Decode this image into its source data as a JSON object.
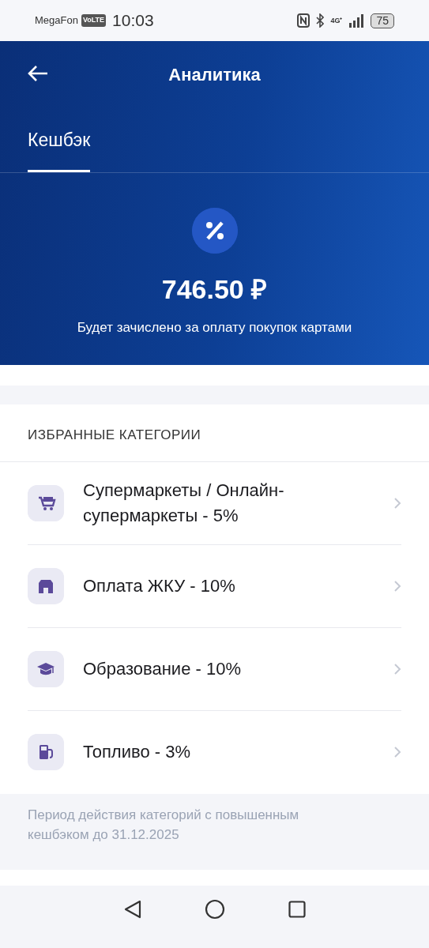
{
  "status_bar": {
    "carrier": "MegaFon",
    "volte": "VoLTE",
    "time": "10:03",
    "network": "4G⁺",
    "battery": "75"
  },
  "header": {
    "title": "Аналитика"
  },
  "tabs": [
    {
      "label": "Кешбэк",
      "selected": true
    }
  ],
  "summary": {
    "amount": "746.50 ₽",
    "caption": "Будет зачислено за оплату покупок картами"
  },
  "favorites": {
    "heading": "ИЗБРАННЫЕ КАТЕГОРИИ",
    "items": [
      {
        "kind": "cart",
        "label": "Супермаркеты / Онлайн-супермаркеты - 5%"
      },
      {
        "kind": "house",
        "label": "Оплата ЖКУ - 10%"
      },
      {
        "kind": "education",
        "label": "Образование - 10%"
      },
      {
        "kind": "fuel",
        "label": "Топливо - 3%"
      }
    ],
    "note": "Период действия категорий с повышенным кешбэком до 31.12.2025"
  }
}
